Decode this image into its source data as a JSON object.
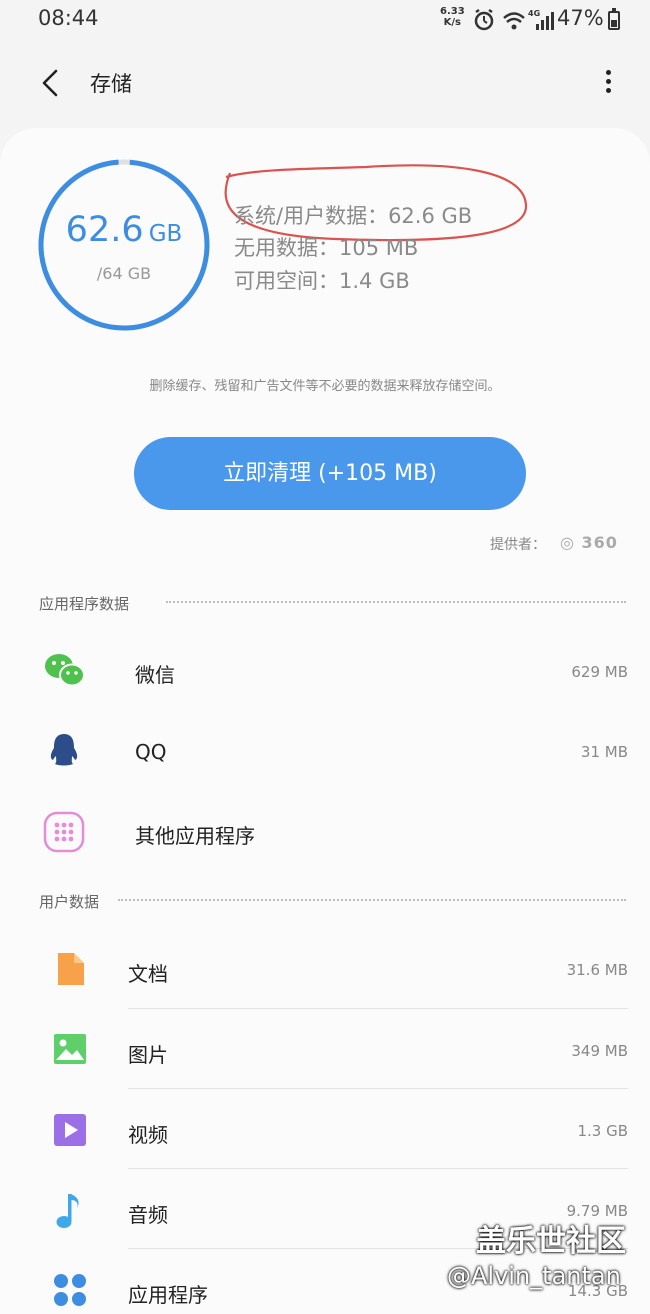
{
  "status_bar": {
    "time": "08:44",
    "net_speed": "6.33",
    "net_unit": "K/s",
    "signal_type": "4G",
    "battery": "47%"
  },
  "header": {
    "title": "存储"
  },
  "storage": {
    "used": "62.6",
    "used_unit": "GB",
    "total": "/64 GB",
    "used_fraction": 0.978,
    "system_user_data": "系统/用户数据：62.6 GB",
    "junk_data": "无用数据：105 MB",
    "available": "可用空间：1.4 GB"
  },
  "hint": "删除缓存、残留和广告文件等不必要的数据来释放存储空间。",
  "clean_button": "立即清理 (+105 MB)",
  "provider": {
    "label": "提供者：",
    "logo_text": "360"
  },
  "sections": {
    "apps": {
      "title": "应用程序数据",
      "items": [
        {
          "name": "微信",
          "size": "629 MB",
          "icon": "wechat-icon"
        },
        {
          "name": "QQ",
          "size": "31 MB",
          "icon": "qq-icon"
        },
        {
          "name": "其他应用程序",
          "size": "",
          "icon": "apps-grid-icon"
        }
      ]
    },
    "user": {
      "title": "用户数据",
      "items": [
        {
          "name": "文档",
          "size": "31.6 MB",
          "icon": "document-icon"
        },
        {
          "name": "图片",
          "size": "349 MB",
          "icon": "image-icon"
        },
        {
          "name": "视频",
          "size": "1.3 GB",
          "icon": "video-icon"
        },
        {
          "name": "音频",
          "size": "9.79 MB",
          "icon": "audio-icon"
        },
        {
          "name": "应用程序",
          "size": "14.3 GB",
          "icon": "apps-icon"
        }
      ]
    }
  },
  "watermark": {
    "line1": "盖乐世社区",
    "line2": "@Alvin_tantan"
  },
  "colors": {
    "accent": "#4a98ec",
    "ring": "#3d8de0",
    "annotation": "#d9534f"
  }
}
